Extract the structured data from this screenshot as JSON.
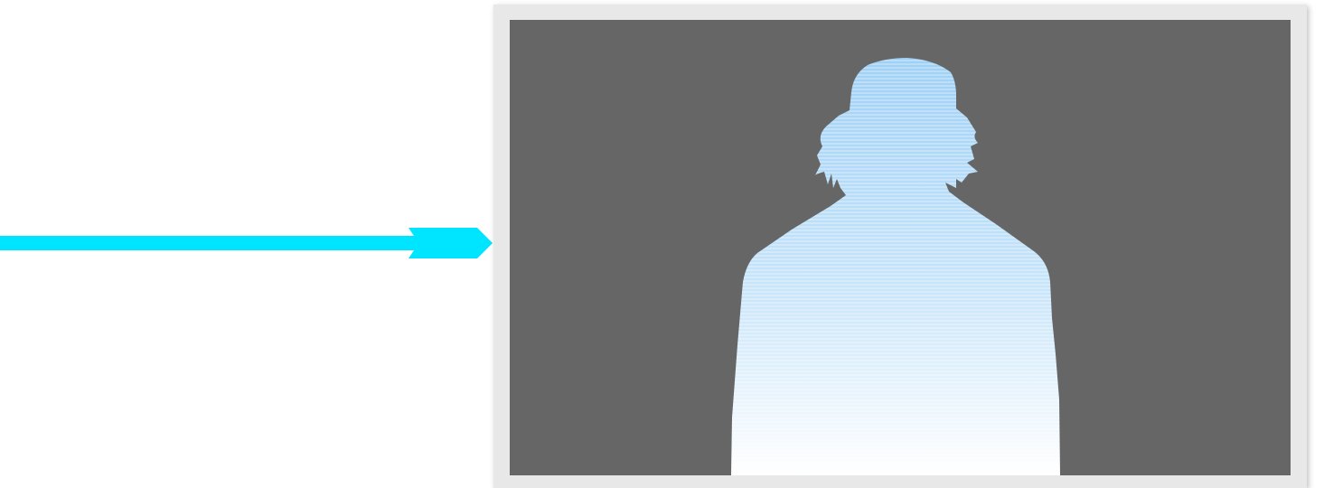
{
  "arrow": {
    "color": "#00e5ff",
    "direction": "right"
  },
  "frame": {
    "border_color": "#e8e8e8"
  },
  "screen": {
    "background_color": "#666666",
    "content": "silhouette-of-person",
    "silhouette_colors": {
      "top": "#9fd0f5",
      "bottom": "#ffffff"
    },
    "pattern": "horizontal-scanlines"
  }
}
